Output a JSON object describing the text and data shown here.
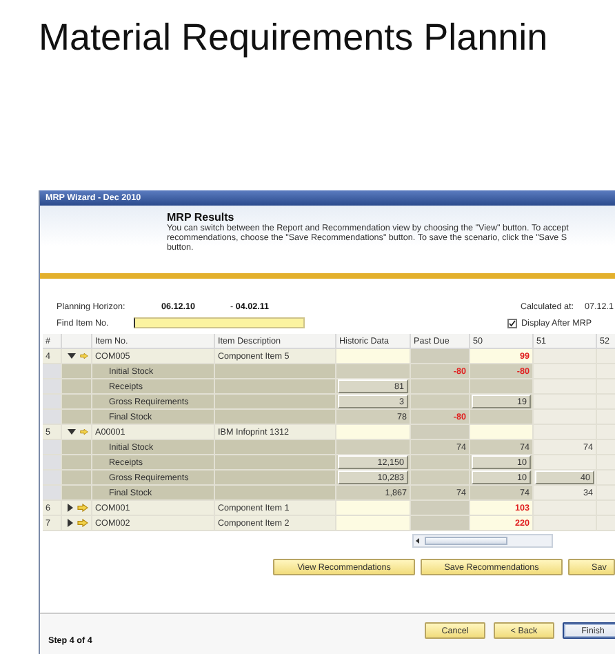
{
  "page_title": "Material Requirements Plannin",
  "window": {
    "title": "MRP Wizard - Dec 2010"
  },
  "header": {
    "title": "MRP Results",
    "description_lines": [
      "You can switch between the Report and Recommendation view by choosing the \"View\" button. To accept",
      "recommendations, choose the \"Save Recommendations\" button. To save the scenario, click the \"Save S",
      "button."
    ]
  },
  "planning": {
    "horizon_label": "Planning Horizon:",
    "from": "06.12.10",
    "separator": "-",
    "to": "04.02.11",
    "calculated_label": "Calculated at:",
    "calculated_value": "07.12.1",
    "find_label": "Find Item No.",
    "display_after_mrp": {
      "label": "Display After MRP",
      "checked": true
    }
  },
  "table": {
    "columns": [
      "#",
      "Item No.",
      "Item Description",
      "Historic Data",
      "Past Due",
      "50",
      "51",
      "52"
    ],
    "rows": [
      {
        "number": "4",
        "expanded": true,
        "item_no": "COM005",
        "description": "Component Item 5",
        "cells": [
          null,
          null,
          {
            "text": "99",
            "boxed": false,
            "alert": true
          },
          null,
          null
        ],
        "children": [
          {
            "label": "Initial Stock",
            "cells": [
              null,
              {
                "text": "-80",
                "boxed": false,
                "alert": true
              },
              {
                "text": "-80",
                "boxed": false,
                "alert": true
              },
              null,
              null
            ]
          },
          {
            "label": "Receipts",
            "cells": [
              {
                "text": "81",
                "boxed": true,
                "alert": false
              },
              null,
              null,
              null,
              null
            ]
          },
          {
            "label": "Gross Requirements",
            "cells": [
              {
                "text": "3",
                "boxed": true,
                "alert": false
              },
              null,
              {
                "text": "19",
                "boxed": true,
                "alert": false
              },
              null,
              null
            ]
          },
          {
            "label": "Final Stock",
            "cells": [
              {
                "text": "78",
                "boxed": false,
                "alert": false
              },
              {
                "text": "-80",
                "boxed": false,
                "alert": true
              },
              null,
              null,
              null
            ]
          }
        ]
      },
      {
        "number": "5",
        "expanded": true,
        "item_no": "A00001",
        "description": "IBM Infoprint 1312",
        "cells": [
          null,
          null,
          null,
          null,
          null
        ],
        "children": [
          {
            "label": "Initial Stock",
            "cells": [
              null,
              {
                "text": "74",
                "boxed": false,
                "alert": false
              },
              {
                "text": "74",
                "boxed": false,
                "alert": false
              },
              {
                "text": "74",
                "boxed": false,
                "alert": false
              },
              null
            ]
          },
          {
            "label": "Receipts",
            "cells": [
              {
                "text": "12,150",
                "boxed": true,
                "alert": false
              },
              null,
              {
                "text": "10",
                "boxed": true,
                "alert": false
              },
              null,
              null
            ]
          },
          {
            "label": "Gross Requirements",
            "cells": [
              {
                "text": "10,283",
                "boxed": true,
                "alert": false
              },
              null,
              {
                "text": "10",
                "boxed": true,
                "alert": false
              },
              {
                "text": "40",
                "boxed": true,
                "alert": false
              },
              null
            ]
          },
          {
            "label": "Final Stock",
            "cells": [
              {
                "text": "1,867",
                "boxed": false,
                "alert": false
              },
              {
                "text": "74",
                "boxed": false,
                "alert": false
              },
              {
                "text": "74",
                "boxed": false,
                "alert": false
              },
              {
                "text": "34",
                "boxed": false,
                "alert": false
              },
              null
            ]
          }
        ]
      },
      {
        "number": "6",
        "expanded": false,
        "item_no": "COM001",
        "description": "Component Item 1",
        "cells": [
          null,
          null,
          {
            "text": "103",
            "boxed": false,
            "alert": true
          },
          null,
          null
        ]
      },
      {
        "number": "7",
        "expanded": false,
        "item_no": "COM002",
        "description": "Component Item 2",
        "cells": [
          null,
          null,
          {
            "text": "220",
            "boxed": false,
            "alert": true
          },
          null,
          null
        ]
      }
    ]
  },
  "action_buttons": [
    "View Recommendations",
    "Save Recommendations",
    "Sav"
  ],
  "footer": {
    "step": "Step 4 of 4",
    "buttons": [
      {
        "label": "Cancel",
        "default": false
      },
      {
        "label": "< Back",
        "default": false
      },
      {
        "label": "Finish",
        "default": true
      }
    ]
  }
}
